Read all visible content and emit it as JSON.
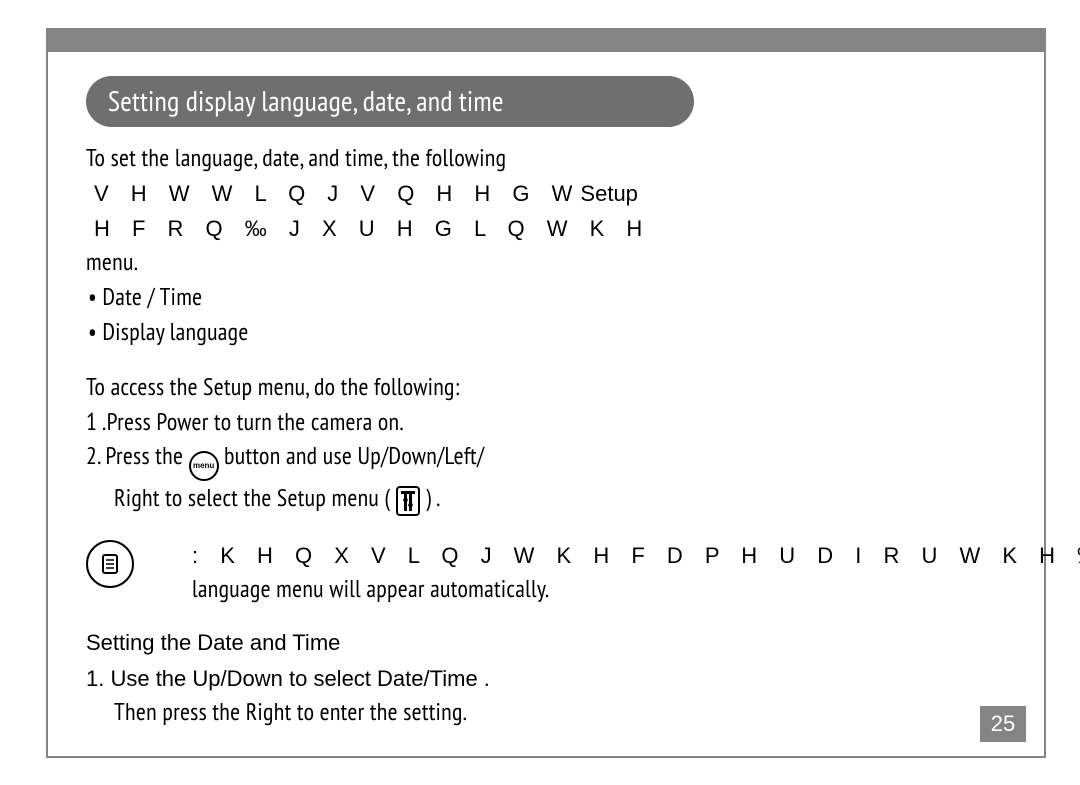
{
  "title": "Setting display language, date, and time",
  "intro_line": "To set the language, date, and time, the following",
  "garbled_line1_a": "V H W W L Q J V  Q H H G  W",
  "garbled_line1_set": "Setup",
  "garbled_line1_b": " H  F R Q ‰ J X U H G  L Q  W K H",
  "menu_label": "menu.",
  "bullet1": "• Date / Time",
  "bullet2": "• Display language",
  "access_line": "To access the Setup  menu, do the following:",
  "step1": "1 .Press  Power   to turn the camera on.",
  "step2a": "2.  Press the ",
  "menu_btn_label": "menu",
  "step2b": " button and use Up/Down/Left/",
  "step2c": "Right  to select the Setup  menu (",
  "step2d": ") .",
  "note_garbled": ": K H Q  X V L Q J  W K H  F D P H U D  I R U  W K H  ‰ U V W  W L P H",
  "note_line2": "language menu will appear automatically.",
  "subhead": "Setting the Date and Time",
  "sub1": "1.  Use the Up/Down  to select Date/Time .",
  "sub2": "Then press the Right  to enter the setting.",
  "page_number": "25"
}
